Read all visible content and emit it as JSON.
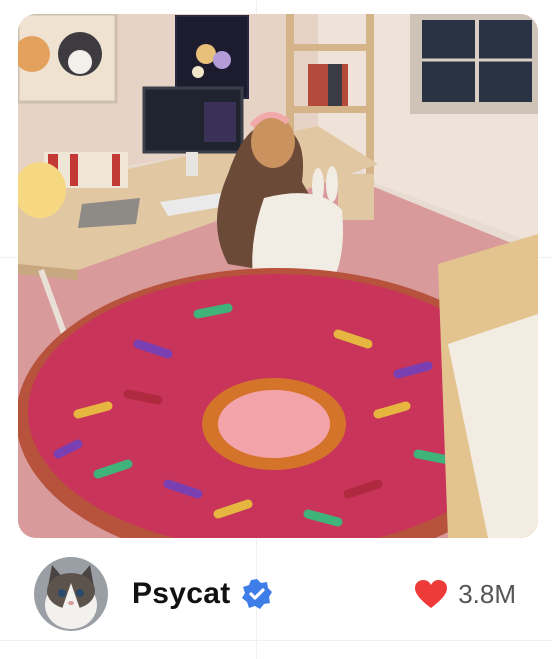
{
  "post": {
    "image_icon": "room-scene-image",
    "user": {
      "name": "Psycat",
      "verified": true,
      "avatar_icon": "cat-avatar-icon"
    },
    "likes": {
      "count": "3.8M",
      "icon": "heart-icon",
      "color": "#ef3a3a"
    },
    "accent": "#3f7de8"
  }
}
